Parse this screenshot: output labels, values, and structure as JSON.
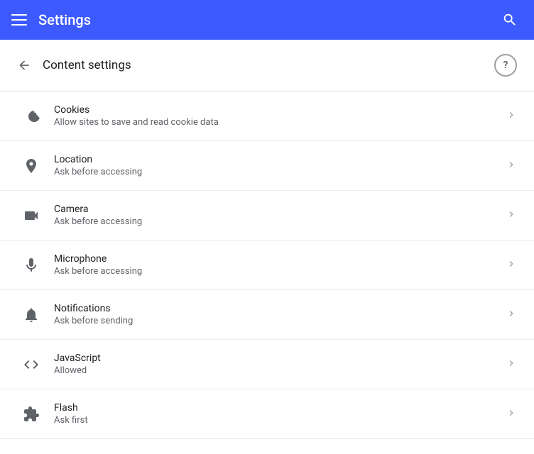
{
  "appBar": {
    "title": "Settings",
    "menuIcon": "hamburger-menu",
    "searchIcon": "search"
  },
  "pageHeader": {
    "backIcon": "back-arrow",
    "title": "Content settings",
    "helpIcon": "help-circle"
  },
  "settingsItems": [
    {
      "id": "cookies",
      "icon": "cookie",
      "title": "Cookies",
      "subtitle": "Allow sites to save and read cookie data"
    },
    {
      "id": "location",
      "icon": "location",
      "title": "Location",
      "subtitle": "Ask before accessing"
    },
    {
      "id": "camera",
      "icon": "camera",
      "title": "Camera",
      "subtitle": "Ask before accessing"
    },
    {
      "id": "microphone",
      "icon": "microphone",
      "title": "Microphone",
      "subtitle": "Ask before accessing"
    },
    {
      "id": "notifications",
      "icon": "bell",
      "title": "Notifications",
      "subtitle": "Ask before sending"
    },
    {
      "id": "javascript",
      "icon": "code",
      "title": "JavaScript",
      "subtitle": "Allowed"
    },
    {
      "id": "flash",
      "icon": "puzzle",
      "title": "Flash",
      "subtitle": "Ask first"
    }
  ]
}
